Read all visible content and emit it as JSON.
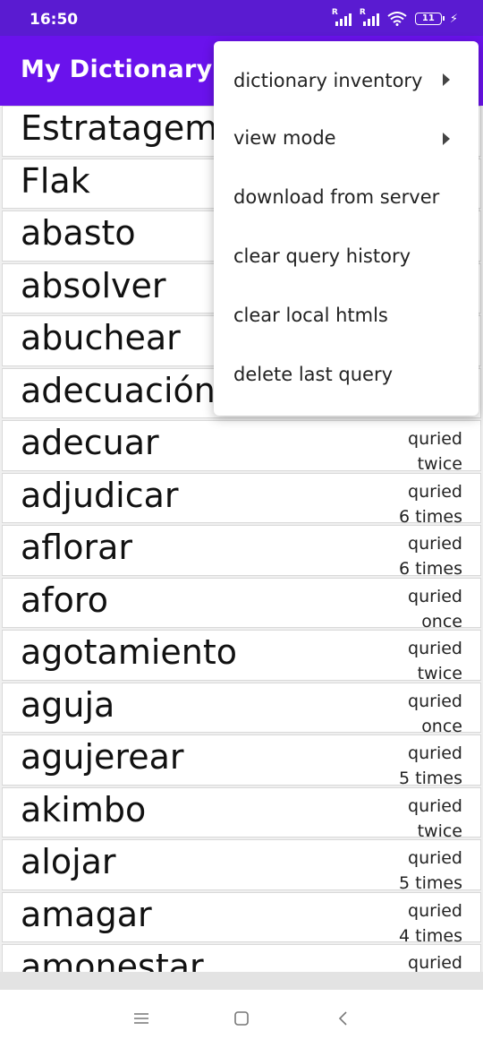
{
  "status_bar": {
    "time": "16:50",
    "sim1": "R",
    "sim2": "R",
    "battery": "11",
    "icons": [
      "signal-icon",
      "signal-icon",
      "wifi-icon",
      "battery-icon",
      "charging-icon"
    ]
  },
  "app_bar": {
    "title": "My Dictionary",
    "color": "#6a12ec"
  },
  "words": [
    {
      "word": "Estratagema",
      "line1": "",
      "line2": ""
    },
    {
      "word": "Flak",
      "line1": "",
      "line2": ""
    },
    {
      "word": "abasto",
      "line1": "",
      "line2": ""
    },
    {
      "word": "absolver",
      "line1": "",
      "line2": ""
    },
    {
      "word": "abuchear",
      "line1": "",
      "line2": ""
    },
    {
      "word": "adecuación",
      "line1": "",
      "line2": ""
    },
    {
      "word": "adecuar",
      "line1": "quried",
      "line2": "twice"
    },
    {
      "word": "adjudicar",
      "line1": "quried",
      "line2": "6 times"
    },
    {
      "word": "aflorar",
      "line1": "quried",
      "line2": "6 times"
    },
    {
      "word": "aforo",
      "line1": "quried",
      "line2": "once"
    },
    {
      "word": "agotamiento",
      "line1": "quried",
      "line2": "twice"
    },
    {
      "word": "aguja",
      "line1": "quried",
      "line2": "once"
    },
    {
      "word": "agujerear",
      "line1": "quried",
      "line2": "5 times"
    },
    {
      "word": "akimbo",
      "line1": "quried",
      "line2": "twice"
    },
    {
      "word": "alojar",
      "line1": "quried",
      "line2": "5 times"
    },
    {
      "word": "amagar",
      "line1": "quried",
      "line2": "4 times"
    },
    {
      "word": "amonestar",
      "line1": "quried",
      "line2": ""
    }
  ],
  "overflow_menu": {
    "items": [
      {
        "label": "dictionary inventory",
        "has_submenu": true
      },
      {
        "label": "view mode",
        "has_submenu": true
      },
      {
        "label": "download from server",
        "has_submenu": false
      },
      {
        "label": "clear query history",
        "has_submenu": false
      },
      {
        "label": "clear local htmls",
        "has_submenu": false
      },
      {
        "label": "delete last query",
        "has_submenu": false
      }
    ]
  },
  "nav_bar": {
    "icons": [
      "menu-icon",
      "home-icon",
      "back-icon"
    ]
  }
}
